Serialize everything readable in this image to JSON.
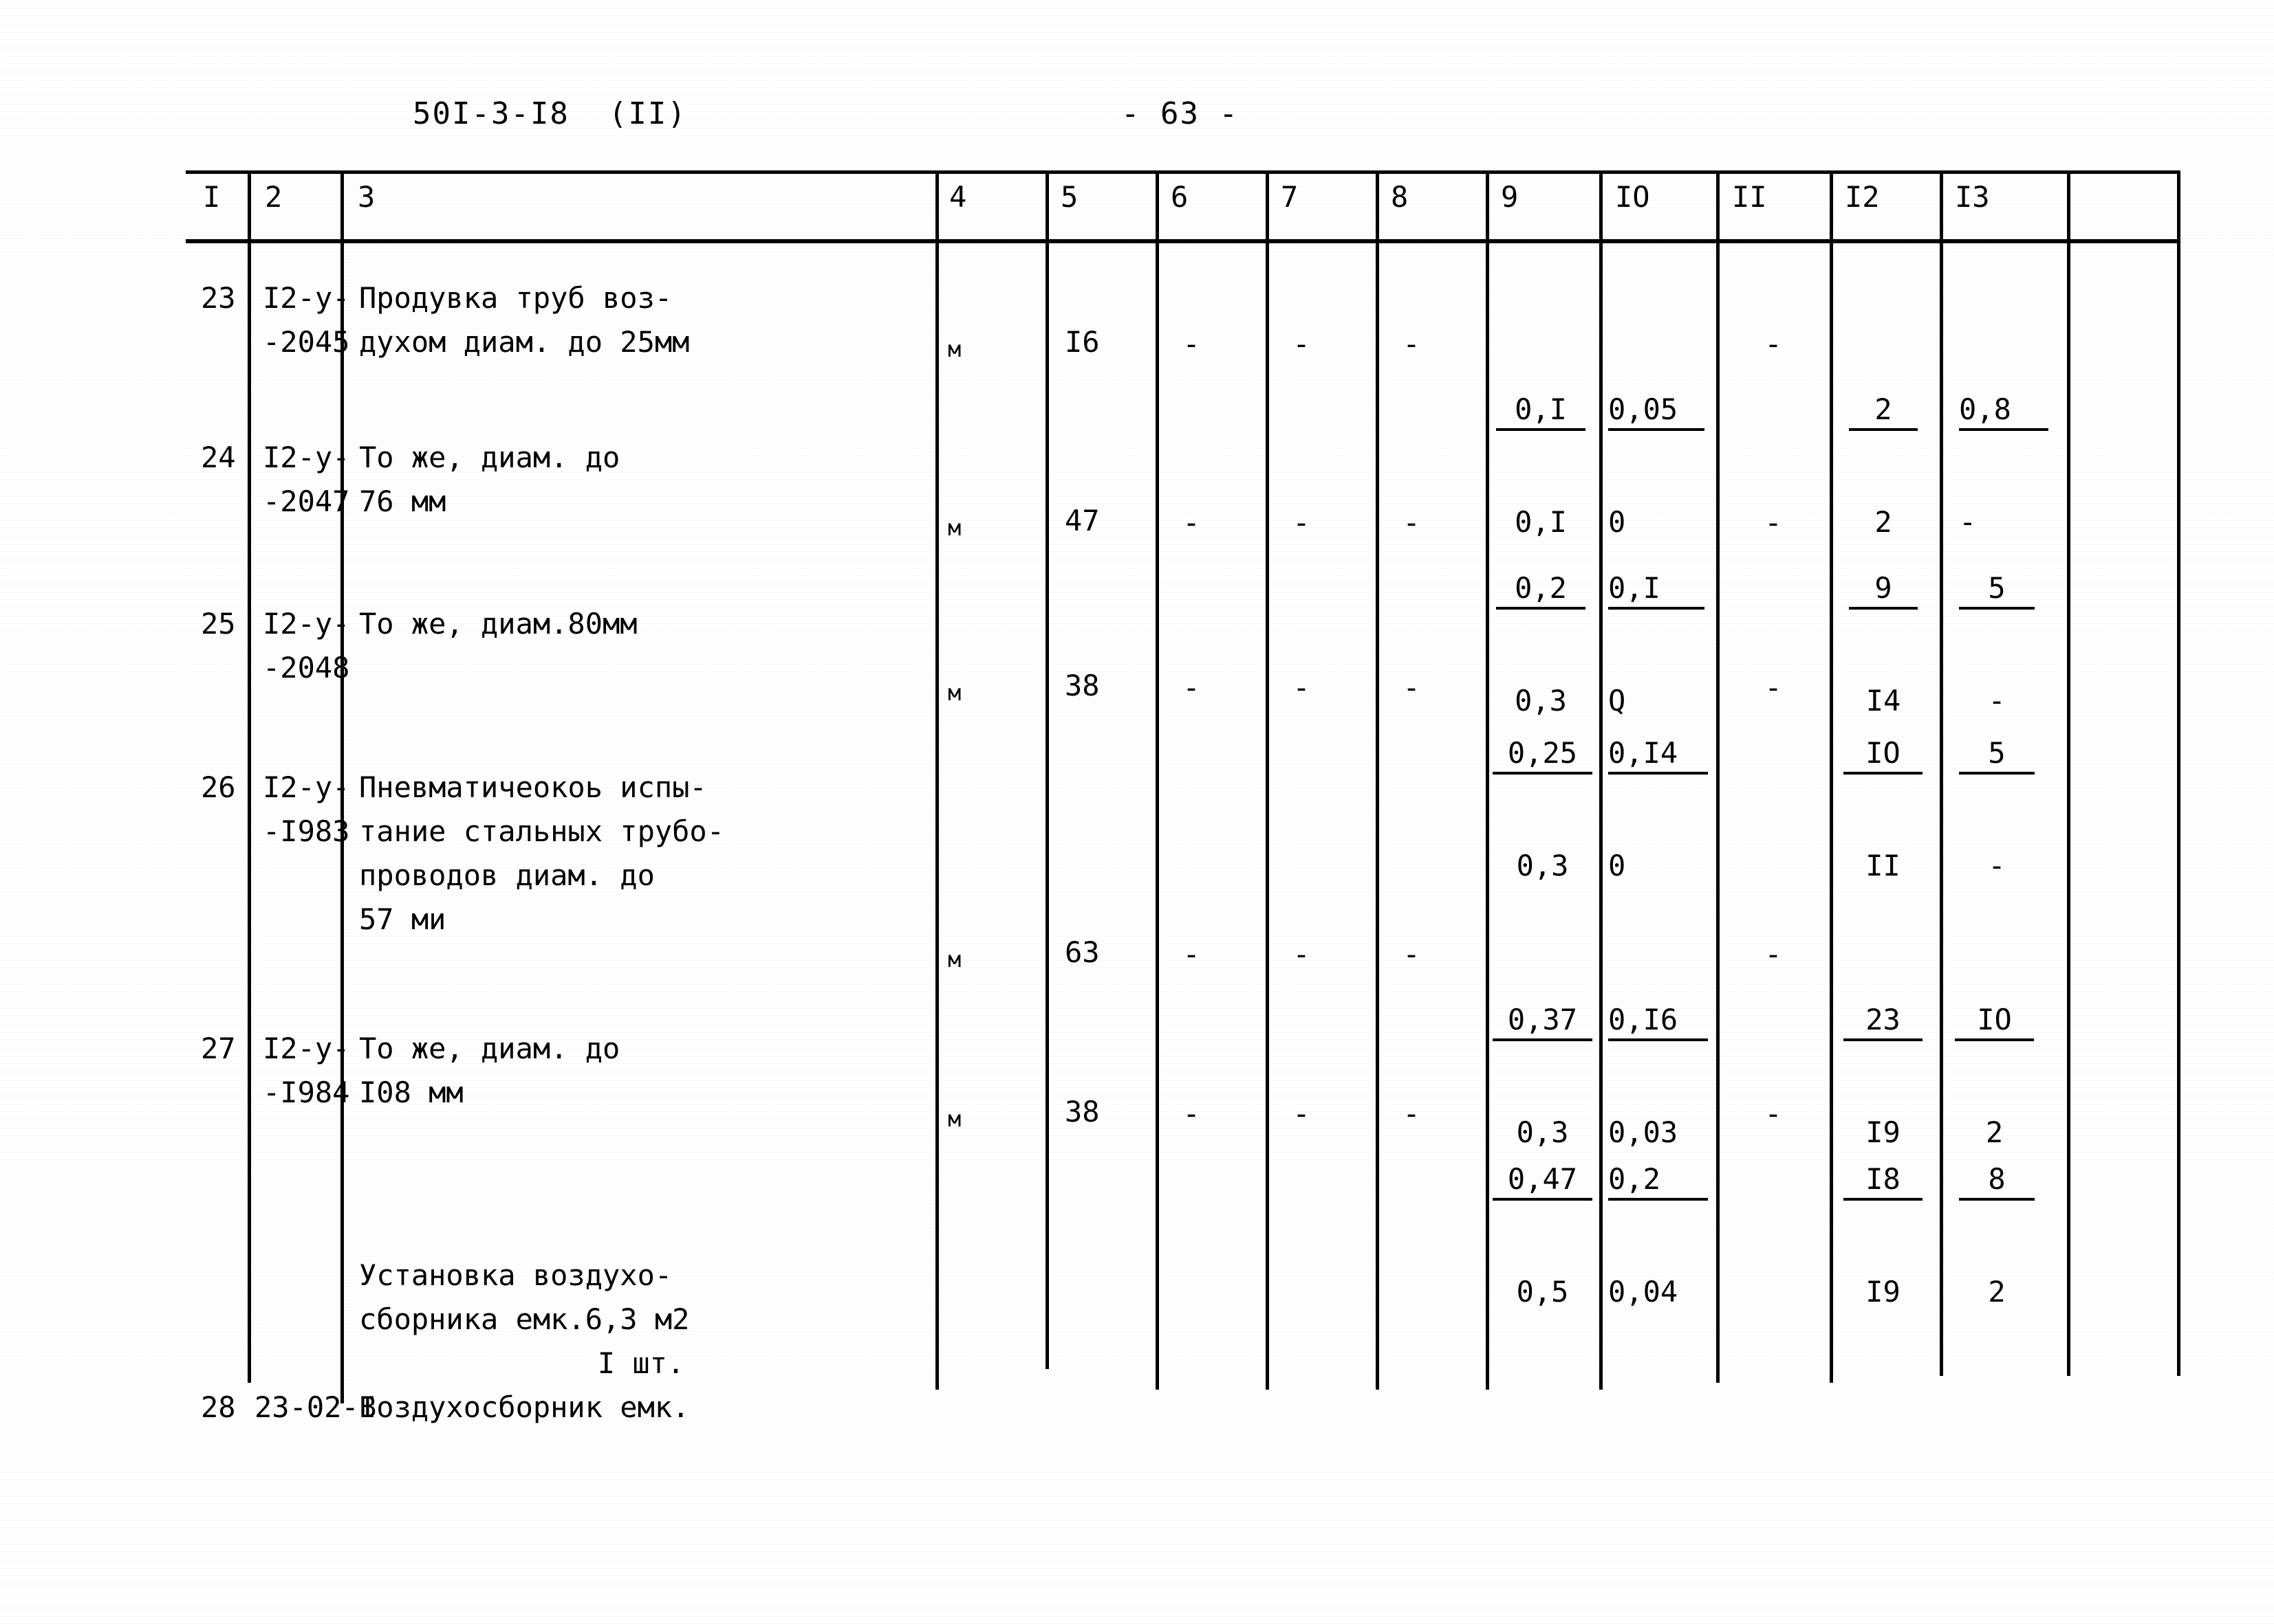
{
  "header": {
    "doc_code": "50I-3-I8  (II)",
    "page_number": "- 63 -"
  },
  "table": {
    "column_headers": [
      "I",
      "2",
      "3",
      "4",
      "5",
      "6",
      "7",
      "8",
      "9",
      "IO",
      "II",
      "I2",
      "I3"
    ],
    "rows": [
      {
        "num": "23",
        "code_line1": "I2-у-",
        "code_line2": "-2045",
        "desc_line1": "Продувка труб воз-",
        "desc_line2": "духом диам. до 25мм",
        "desc_line3": "",
        "desc_line4": "",
        "unit": "м",
        "c5": "I6",
        "c6": "-",
        "c7": "-",
        "c8": "-",
        "c9_num": "0,I",
        "c9_den": "0,I",
        "c10_num": "0,05",
        "c10_den": "0",
        "c11": "-",
        "c12_num": "2",
        "c12_den": "2",
        "c13_num": "0,8",
        "c13_den": "-"
      },
      {
        "num": "24",
        "code_line1": "I2-у-",
        "code_line2": "-2047",
        "desc_line1": "То же, диам. до",
        "desc_line2": "76 мм",
        "desc_line3": "",
        "desc_line4": "",
        "unit": "м",
        "c5": "47",
        "c6": "-",
        "c7": "-",
        "c8": "-",
        "c9_num": "0,2",
        "c9_den": "0,3",
        "c10_num": "0,I",
        "c10_den": "Q",
        "c11": "-",
        "c12_num": "9",
        "c12_den": "I4",
        "c13_num": "5",
        "c13_den": "-"
      },
      {
        "num": "25",
        "code_line1": "I2-у-",
        "code_line2": "-2048",
        "desc_line1": "То же, диам.80мм",
        "desc_line2": "",
        "desc_line3": "",
        "desc_line4": "",
        "unit": "м",
        "c5": "38",
        "c6": "-",
        "c7": "-",
        "c8": "-",
        "c9_num": "0,25",
        "c9_den": "0,3",
        "c10_num": "0,I4",
        "c10_den": "0",
        "c11": "-",
        "c12_num": "IO",
        "c12_den": "II",
        "c13_num": "5",
        "c13_den": "-"
      },
      {
        "num": "26",
        "code_line1": "I2-у-",
        "code_line2": "-I983",
        "desc_line1": "Пневматичеокоь испы-",
        "desc_line2": "тание стальных трубо-",
        "desc_line3": "проводов диам. до",
        "desc_line4": "57 ми",
        "unit": "м",
        "c5": "63",
        "c6": "-",
        "c7": "-",
        "c8": "-",
        "c9_num": "0,37",
        "c9_den": "0,3",
        "c10_num": "0,I6",
        "c10_den": "0,03",
        "c11": "-",
        "c12_num": "23",
        "c12_den": "I9",
        "c13_num": "IO",
        "c13_den": "2"
      },
      {
        "num": "27",
        "code_line1": "I2-у-",
        "code_line2": "-I984",
        "desc_line1": "То же, диам. до",
        "desc_line2": "I08 мм",
        "desc_line3": "",
        "desc_line4": "",
        "unit": "м",
        "c5": "38",
        "c6": "-",
        "c7": "-",
        "c8": "-",
        "c9_num": "0,47",
        "c9_den": "0,5",
        "c10_num": "0,2",
        "c10_den": "0,04",
        "c11": "-",
        "c12_num": "I8",
        "c12_den": "I9",
        "c13_num": "8",
        "c13_den": "2"
      },
      {
        "num": "28",
        "code_line1": "",
        "code_line2": "23-02-I",
        "desc_line1": "Установка воздухо-",
        "desc_line2": "сборника емк.6,3 м2",
        "desc_line3": "I шт.",
        "desc_line4": "Воздухосборник емк.",
        "unit": "",
        "c5": "",
        "c6": "",
        "c7": "",
        "c8": "",
        "c9_num": "",
        "c9_den": "",
        "c10_num": "",
        "c10_den": "",
        "c11": "",
        "c12_num": "",
        "c12_den": "",
        "c13_num": "",
        "c13_den": ""
      }
    ]
  }
}
